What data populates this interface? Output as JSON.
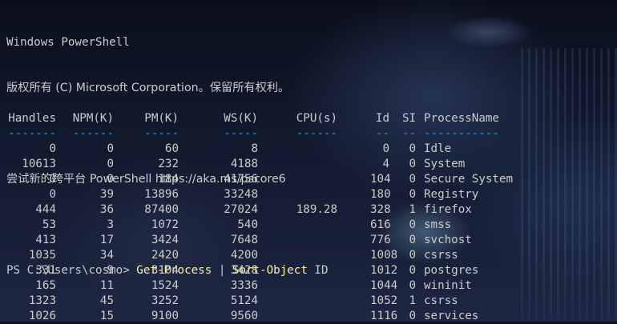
{
  "theme": {
    "text": "#cccccc",
    "command": "#f9f1a5",
    "separator": "#3a96dd"
  },
  "banner": {
    "title": "Windows PowerShell",
    "copyright": "版权所有 (C) Microsoft Corporation。保留所有权利。",
    "tip": "尝试新的跨平台 PowerShell https://aka.ms/pscore6"
  },
  "prompt": {
    "path": "PS C:\\Users\\cosmo>",
    "cmd1": "Get-Process",
    "pipe": "|",
    "cmd2": "Sort-Object",
    "arg": "ID"
  },
  "table": {
    "headers": [
      "Handles",
      "NPM(K)",
      "PM(K)",
      "WS(K)",
      "CPU(s)",
      "Id",
      "SI",
      "ProcessName"
    ],
    "separators": [
      "-------",
      "------",
      "-----",
      "-----",
      "------",
      "--",
      "--",
      "-----------"
    ],
    "rows": [
      [
        "0",
        "0",
        "60",
        "8",
        "",
        "0",
        "0",
        "Idle"
      ],
      [
        "10613",
        "0",
        "232",
        "4188",
        "",
        "4",
        "0",
        "System"
      ],
      [
        "0",
        "0",
        "184",
        "41756",
        "",
        "104",
        "0",
        "Secure System"
      ],
      [
        "0",
        "39",
        "13896",
        "33248",
        "",
        "180",
        "0",
        "Registry"
      ],
      [
        "444",
        "36",
        "87400",
        "27024",
        "189.28",
        "328",
        "1",
        "firefox"
      ],
      [
        "53",
        "3",
        "1072",
        "540",
        "",
        "616",
        "0",
        "smss"
      ],
      [
        "413",
        "17",
        "3424",
        "7648",
        "",
        "776",
        "0",
        "svchost"
      ],
      [
        "1035",
        "34",
        "2420",
        "4200",
        "",
        "1008",
        "0",
        "csrss"
      ],
      [
        "331",
        "9",
        "3104",
        "3428",
        "",
        "1012",
        "0",
        "postgres"
      ],
      [
        "165",
        "11",
        "1524",
        "3336",
        "",
        "1044",
        "0",
        "wininit"
      ],
      [
        "1323",
        "45",
        "3252",
        "5124",
        "",
        "1052",
        "1",
        "csrss"
      ],
      [
        "1026",
        "15",
        "9100",
        "9560",
        "",
        "1116",
        "0",
        "services"
      ]
    ]
  }
}
